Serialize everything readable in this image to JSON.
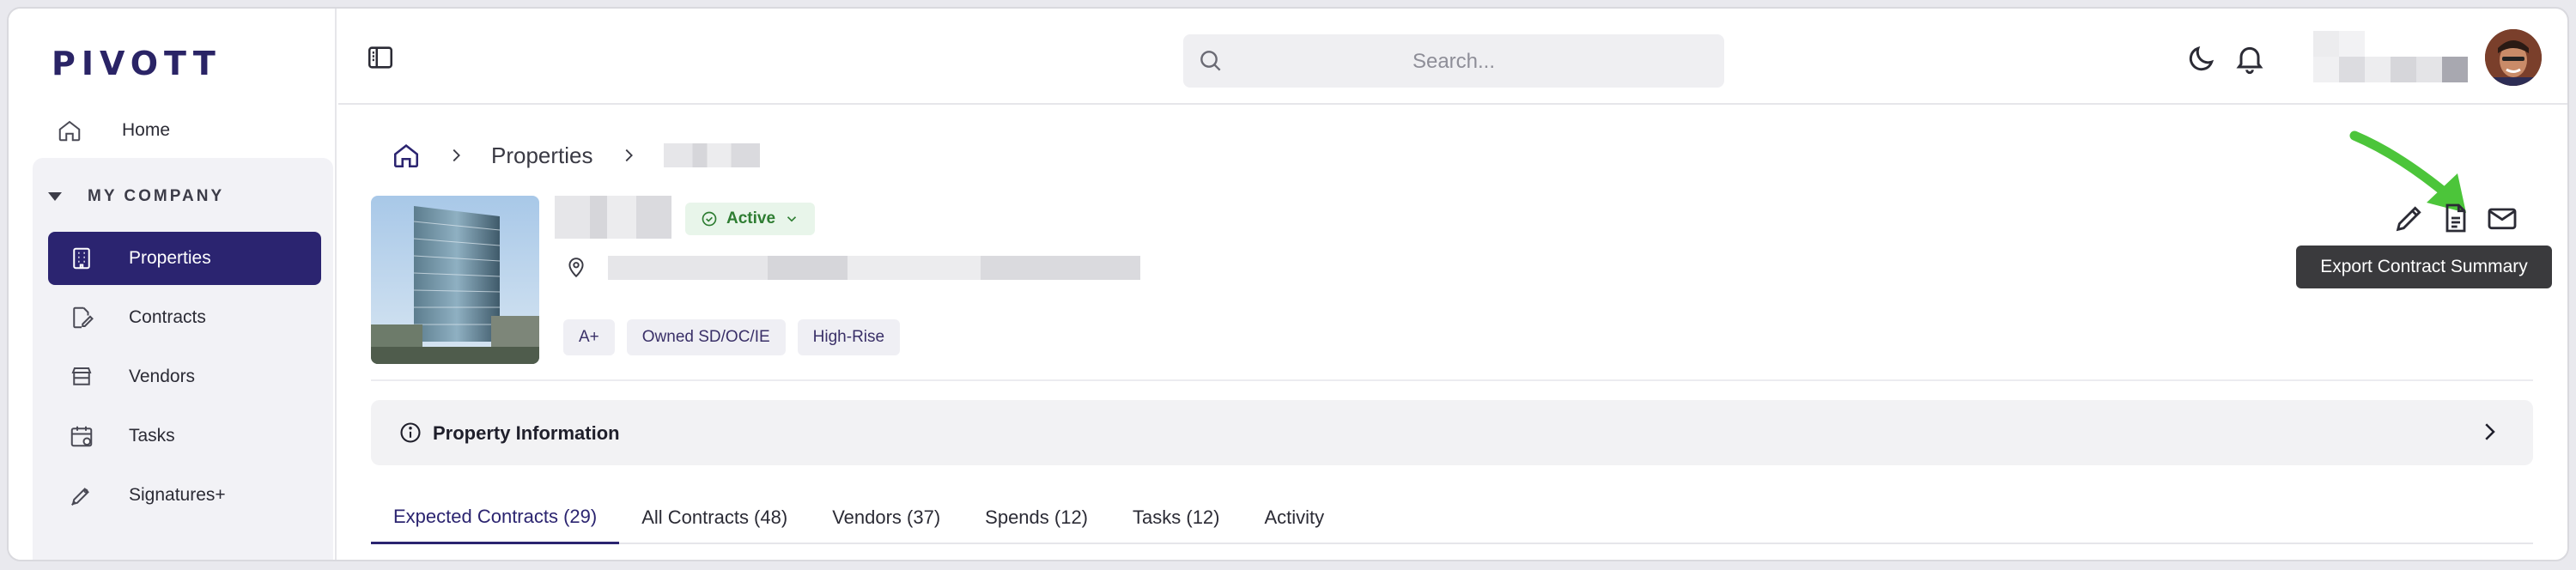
{
  "app": {
    "logo": "PIVOTT"
  },
  "sidebar": {
    "home_label": "Home",
    "section_label": "MY COMPANY",
    "items": [
      {
        "label": "Properties",
        "icon": "building-icon",
        "active": true
      },
      {
        "label": "Contracts",
        "icon": "contract-icon",
        "active": false
      },
      {
        "label": "Vendors",
        "icon": "vendors-icon",
        "active": false
      },
      {
        "label": "Tasks",
        "icon": "calendar-icon",
        "active": false
      },
      {
        "label": "Signatures+",
        "icon": "pen-nib-icon",
        "active": false
      }
    ]
  },
  "header": {
    "search_placeholder": "Search...",
    "icons": [
      "sidebar-toggle-icon",
      "search-icon",
      "moon-icon",
      "bell-icon",
      "avatar"
    ]
  },
  "breadcrumb": {
    "items": [
      "Properties"
    ]
  },
  "property": {
    "status": "Active",
    "tags": [
      "A+",
      "Owned SD/OC/IE",
      "High-Rise"
    ]
  },
  "actions": {
    "icons": [
      "edit-icon",
      "document-icon",
      "mail-icon"
    ],
    "tooltip": "Export Contract Summary"
  },
  "info_panel": {
    "title": "Property Information"
  },
  "tabs": [
    {
      "label": "Expected Contracts (29)",
      "active": true
    },
    {
      "label": "All Contracts (48)",
      "active": false
    },
    {
      "label": "Vendors (37)",
      "active": false
    },
    {
      "label": "Spends (12)",
      "active": false
    },
    {
      "label": "Tasks (12)",
      "active": false
    },
    {
      "label": "Activity",
      "active": false
    }
  ],
  "colors": {
    "brand": "#2b2470",
    "active_status_bg": "#e8f5ea",
    "active_status_text": "#2e7d32",
    "annotation_arrow": "#4cc53a",
    "tooltip_bg": "#3a3a3d"
  }
}
